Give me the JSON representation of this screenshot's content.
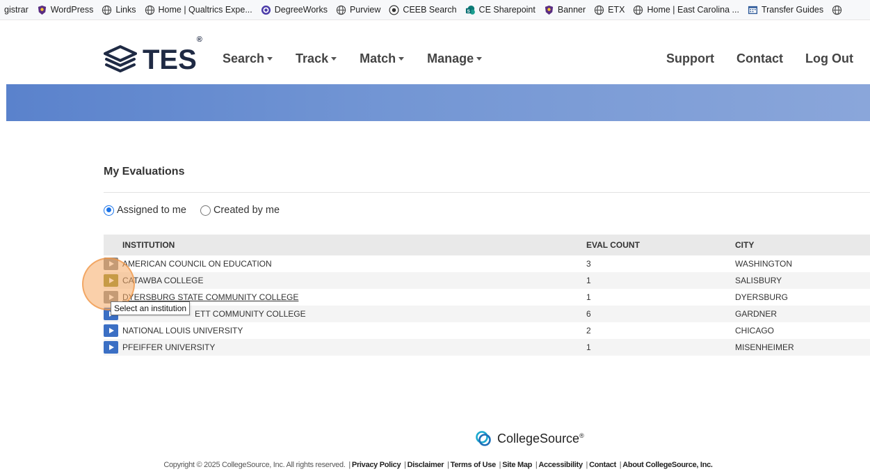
{
  "bookmarks": [
    {
      "label": "gistrar",
      "icon": "none"
    },
    {
      "label": "WordPress",
      "icon": "pirate-shield-icon"
    },
    {
      "label": "Links",
      "icon": "globe-icon"
    },
    {
      "label": "Home | Qualtrics Expe...",
      "icon": "globe-icon"
    },
    {
      "label": "DegreeWorks",
      "icon": "degreeworks-icon"
    },
    {
      "label": "Purview",
      "icon": "globe-icon"
    },
    {
      "label": "CEEB Search",
      "icon": "ceeb-icon"
    },
    {
      "label": "CE Sharepoint",
      "icon": "sharepoint-icon"
    },
    {
      "label": "Banner",
      "icon": "pirate-shield-icon"
    },
    {
      "label": "ETX",
      "icon": "globe-icon"
    },
    {
      "label": "Home | East Carolina ...",
      "icon": "globe-icon"
    },
    {
      "label": "Transfer Guides",
      "icon": "calendar-icon"
    }
  ],
  "header": {
    "logo_text": "TES",
    "logo_mark": "®",
    "nav": [
      {
        "label": "Search"
      },
      {
        "label": "Track"
      },
      {
        "label": "Match"
      },
      {
        "label": "Manage"
      }
    ],
    "nav_right": [
      {
        "label": "Support"
      },
      {
        "label": "Contact"
      },
      {
        "label": "Log Out"
      }
    ]
  },
  "colors": {
    "banner_start": "#5a82cc",
    "banner_end": "#8aa6da",
    "button_blue": "#3b6fc4",
    "radio_selected": "#1a73e8"
  },
  "main": {
    "title": "My Evaluations",
    "filters": [
      {
        "label": "Assigned to me",
        "selected": true
      },
      {
        "label": "Created by me",
        "selected": false
      }
    ],
    "table": {
      "headers": [
        "INSTITUTION",
        "EVAL COUNT",
        "CITY"
      ],
      "rows": [
        {
          "institution": "AMERICAN COUNCIL ON EDUCATION",
          "eval_count": "3",
          "city": "WASHINGTON"
        },
        {
          "institution": "CATAWBA COLLEGE",
          "eval_count": "1",
          "city": "SALISBURY"
        },
        {
          "institution": "DYERSBURG STATE COMMUNITY COLLEGE",
          "eval_count": "1",
          "city": "DYERSBURG"
        },
        {
          "institution": "ETT COMMUNITY COLLEGE",
          "eval_count": "6",
          "city": "GARDNER"
        },
        {
          "institution": "NATIONAL LOUIS UNIVERSITY",
          "eval_count": "2",
          "city": "CHICAGO"
        },
        {
          "institution": "PFEIFFER UNIVERSITY",
          "eval_count": "1",
          "city": "MISENHEIMER"
        }
      ]
    },
    "tooltip": "Select an institution"
  },
  "footer": {
    "brand": "CollegeSource",
    "brand_mark": "®",
    "copyright": "Copyright © 2025 CollegeSource, Inc. All rights reserved.",
    "links": [
      "Privacy Policy",
      "Disclaimer",
      "Terms of Use",
      "Site Map",
      "Accessibility",
      "Contact",
      "About CollegeSource, Inc."
    ]
  }
}
